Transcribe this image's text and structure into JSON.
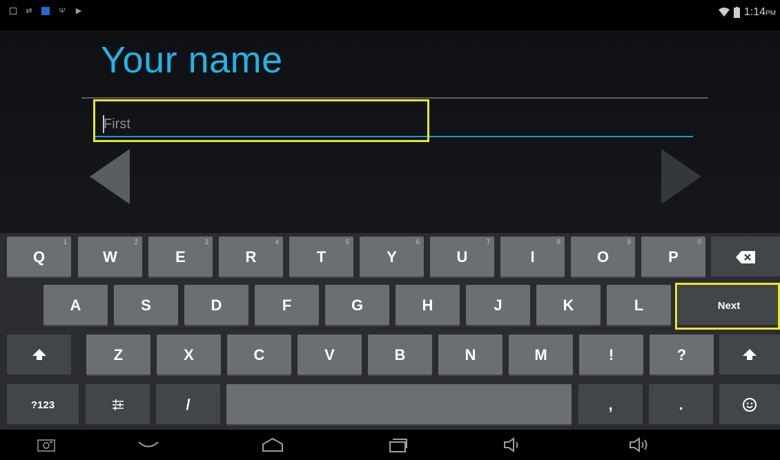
{
  "status_bar": {
    "time": "1:14",
    "ampm": "PM",
    "left_icons": [
      "gallery-icon",
      "usb-transfer-icon",
      "blue-app-icon",
      "usb-icon",
      "play-store-icon"
    ],
    "right_icons": [
      "wifi-icon",
      "battery-icon"
    ]
  },
  "page": {
    "title": "Your name",
    "first_field": {
      "placeholder": "First",
      "value": ""
    }
  },
  "keyboard": {
    "row1": [
      {
        "label": "Q",
        "hint": "1"
      },
      {
        "label": "W",
        "hint": "2"
      },
      {
        "label": "E",
        "hint": "3"
      },
      {
        "label": "R",
        "hint": "4"
      },
      {
        "label": "T",
        "hint": "5"
      },
      {
        "label": "Y",
        "hint": "6"
      },
      {
        "label": "U",
        "hint": "7"
      },
      {
        "label": "I",
        "hint": "8"
      },
      {
        "label": "O",
        "hint": "9"
      },
      {
        "label": "P",
        "hint": "0"
      }
    ],
    "backspace_icon": "backspace-icon",
    "row2": [
      "A",
      "S",
      "D",
      "F",
      "G",
      "H",
      "J",
      "K",
      "L"
    ],
    "next_label": "Next",
    "row3": [
      "Z",
      "X",
      "C",
      "V",
      "B",
      "N",
      "M",
      "!",
      "?"
    ],
    "shift_icon": "shift-icon",
    "row4": {
      "symbols": "?123",
      "settings_icon": "settings-icon",
      "slash": "/",
      "comma": ",",
      "period": ".",
      "emoji_icon": "emoji-icon"
    }
  },
  "nav_bar": [
    "camera-icon",
    "back-icon",
    "home-icon",
    "recents-icon",
    "volume-down-icon",
    "volume-up-icon"
  ],
  "colors": {
    "accent": "#22b4e5",
    "highlight": "#e8e82a",
    "key": "#6b6e72",
    "key_dark": "#434649"
  }
}
